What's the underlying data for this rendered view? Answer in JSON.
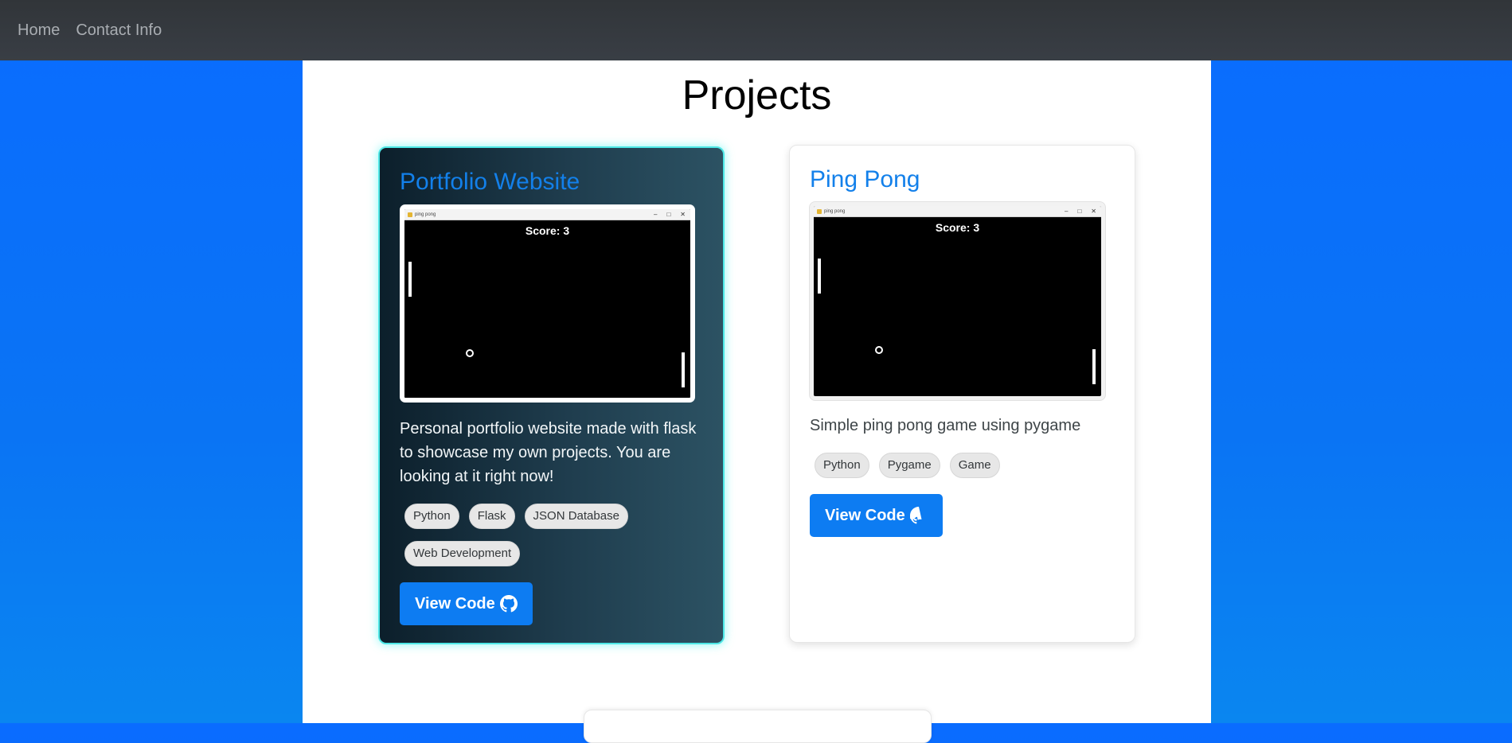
{
  "nav": {
    "home": "Home",
    "contact": "Contact Info"
  },
  "page": {
    "title": "Projects"
  },
  "projects": [
    {
      "title": "Portfolio Website",
      "screenshot": {
        "window_title": "ping pong",
        "score": "Score: 3"
      },
      "description": "Personal portfolio website made with flask to showcase my own projects. You are looking at it right now!",
      "tags": [
        "Python",
        "Flask",
        "JSON Database",
        "Web Development"
      ],
      "button": "View Code"
    },
    {
      "title": "Ping Pong",
      "screenshot": {
        "window_title": "ping pong",
        "score": "Score: 3"
      },
      "description": "Simple ping pong game using pygame",
      "tags": [
        "Python",
        "Pygame",
        "Game"
      ],
      "button": "View Code"
    }
  ],
  "colors": {
    "accent": "#0d7cf2",
    "highlight_glow": "#4ee7e6",
    "background": "#0a6cff"
  },
  "icons": {
    "button_icon": "github-icon"
  }
}
